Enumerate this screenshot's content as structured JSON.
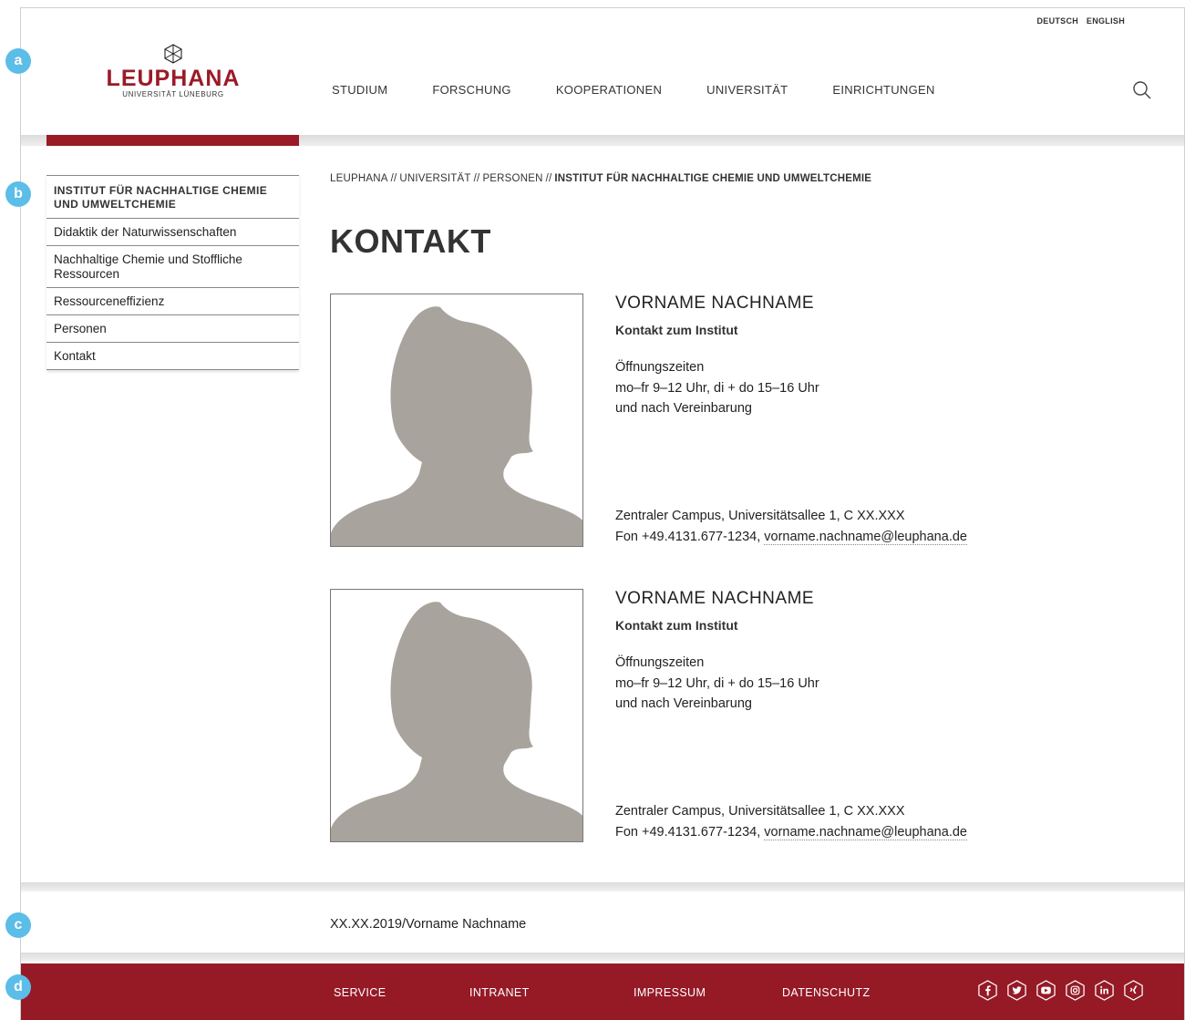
{
  "markers": {
    "a": "a",
    "b": "b",
    "c": "c",
    "d": "d"
  },
  "lang": {
    "de": "DEUTSCH",
    "en": "ENGLISH"
  },
  "logo": {
    "word": "LEUPHANA",
    "sub": "UNIVERSITÄT LÜNEBURG",
    "brand_color": "#9a1b27"
  },
  "nav": {
    "items": [
      {
        "label": "STUDIUM"
      },
      {
        "label": "FORSCHUNG"
      },
      {
        "label": "KOOPERATIONEN"
      },
      {
        "label": "UNIVERSITÄT"
      },
      {
        "label": "EINRICHTUNGEN"
      }
    ],
    "search_icon": "search-icon"
  },
  "sidebar": {
    "title": "INSTITUT FÜR NACHHALTIGE CHEMIE UND UMWELTCHEMIE",
    "items": [
      {
        "label": "Didaktik der Naturwissenschaften"
      },
      {
        "label": "Nachhaltige Chemie und Stoffliche Ressourcen"
      },
      {
        "label": "Ressourceneffizienz"
      },
      {
        "label": "Personen"
      },
      {
        "label": "Kontakt"
      }
    ]
  },
  "breadcrumb": {
    "items": [
      {
        "label": "LEUPHANA"
      },
      {
        "label": "UNIVERSITÄT"
      },
      {
        "label": "PERSONEN"
      }
    ],
    "separator": "//",
    "current": "INSTITUT FÜR NACHHALTIGE CHEMIE UND UMWELTCHEMIE"
  },
  "page": {
    "title": "KONTAKT"
  },
  "contacts": [
    {
      "name": "VORNAME NACHNAME",
      "role": "Kontakt zum Institut",
      "hours_label": "Öffnungszeiten",
      "hours_line1": "mo–fr 9–12 Uhr, di + do 15–16 Uhr",
      "hours_line2": "und nach Vereinbarung",
      "address": "Zentraler Campus, Universitätsallee 1, C XX.XXX",
      "phone": "Fon +49.4131.677-1234, ",
      "email": "vorname.nachname@leuphana.de"
    },
    {
      "name": "VORNAME NACHNAME",
      "role": "Kontakt zum Institut",
      "hours_label": "Öffnungszeiten",
      "hours_line1": "mo–fr 9–12 Uhr, di + do 15–16 Uhr",
      "hours_line2": "und nach Vereinbarung",
      "address": "Zentraler Campus, Universitätsallee 1, C XX.XXX",
      "phone": "Fon +49.4131.677-1234, ",
      "email": "vorname.nachname@leuphana.de"
    }
  ],
  "meta": {
    "text": "XX.XX.2019/Vorname Nachname"
  },
  "footer": {
    "links": [
      {
        "label": "SERVICE"
      },
      {
        "label": "INTRANET"
      },
      {
        "label": "IMPRESSUM"
      },
      {
        "label": "DATENSCHUTZ"
      }
    ],
    "social_icons": [
      "facebook-icon",
      "twitter-icon",
      "youtube-icon",
      "instagram-icon",
      "linkedin-icon",
      "xing-icon"
    ],
    "background_color": "#951a26"
  }
}
